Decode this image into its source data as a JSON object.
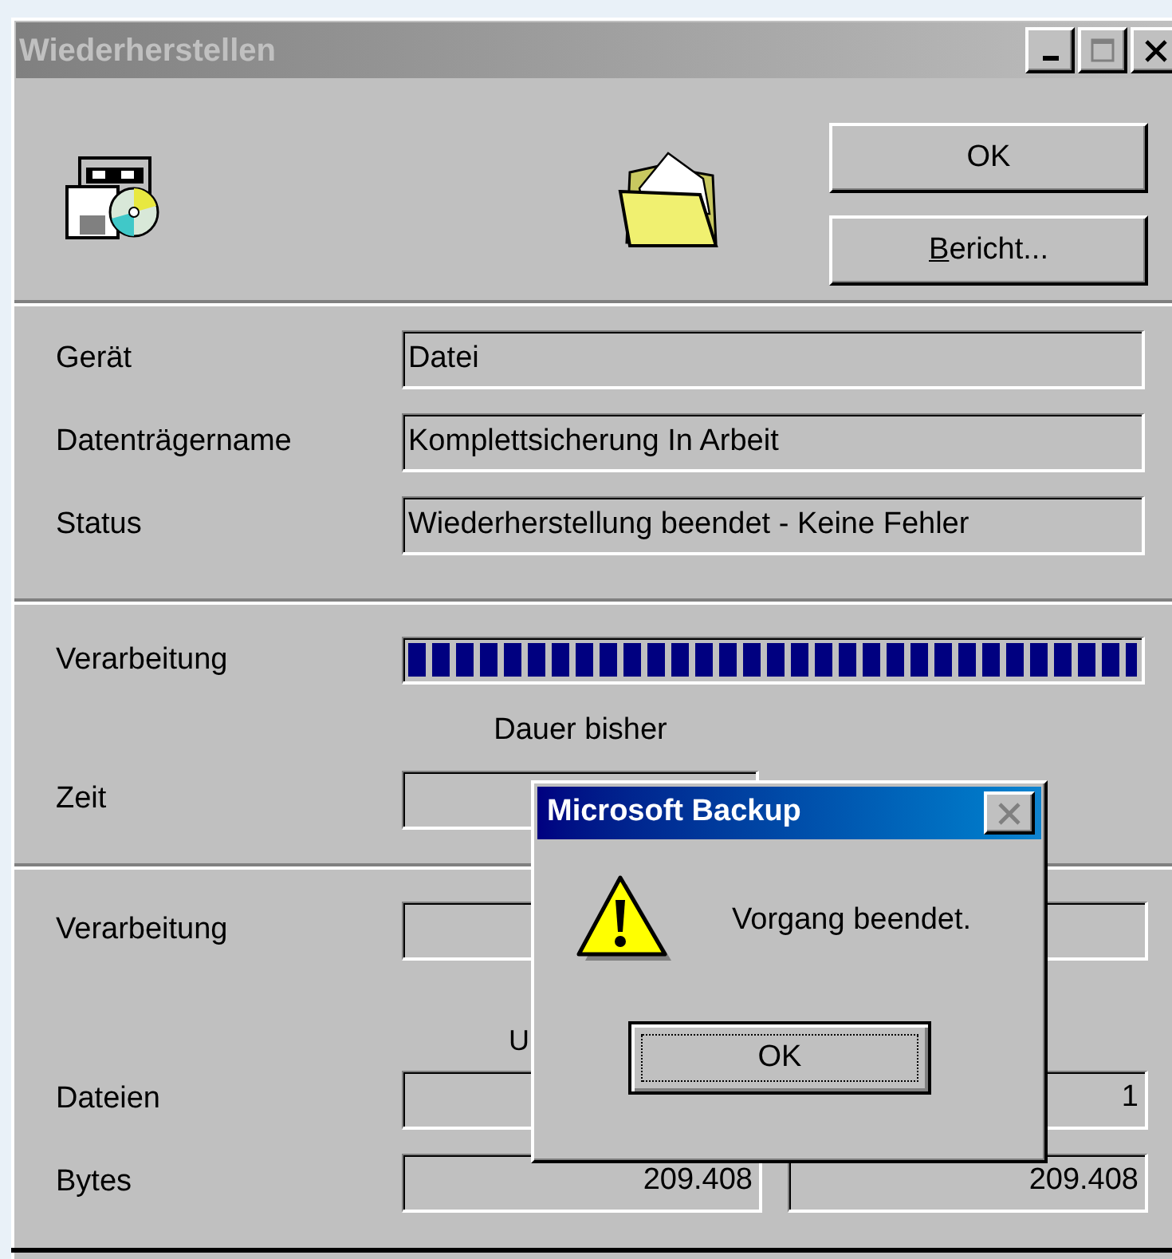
{
  "window": {
    "title": "Wiederherstellen",
    "controls": [
      {
        "kind": "minimize"
      },
      {
        "kind": "maximize"
      },
      {
        "kind": "close"
      }
    ]
  },
  "buttons": [
    {
      "label": "OK",
      "accelerator": false
    },
    {
      "label": "Bericht...",
      "accelerator": true
    }
  ],
  "info_fields": [
    {
      "label": "Gerät",
      "value": "Datei"
    },
    {
      "label": "Datenträgername",
      "value": "Komplettsicherung In Arbeit"
    },
    {
      "label": "Status",
      "value": "Wiederherstellung beendet - Keine Fehler"
    }
  ],
  "progress": {
    "label": "Verarbeitung",
    "level": 1
  },
  "time": {
    "heading": "Dauer bisher",
    "label": "Zeit"
  },
  "stats": {
    "column_heading": "U",
    "rows": [
      {
        "label": "Verarbeitung",
        "cells": [
          {},
          {}
        ]
      },
      {
        "label": "Dateien",
        "cells": [
          {},
          {
            "value": "1"
          }
        ]
      },
      {
        "label": "Bytes",
        "cells": [
          {
            "value": "209.408"
          },
          {
            "value": "209.408"
          }
        ]
      }
    ]
  },
  "dialog": {
    "title": "Microsoft Backup",
    "message": "Vorgang beendet.",
    "button": "OK"
  }
}
